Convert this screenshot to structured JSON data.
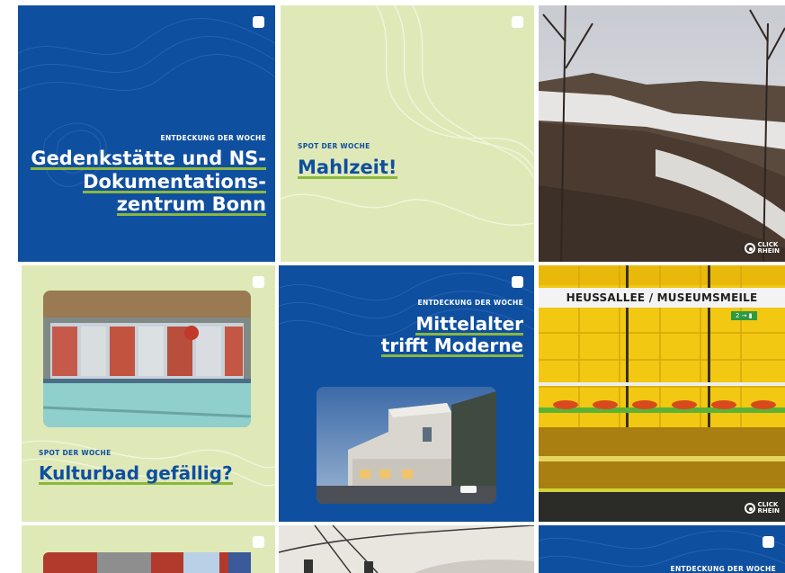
{
  "tiles": {
    "t1": {
      "kicker": "ENTDECKUNG DER WOCHE",
      "lines": [
        "Gedenkstätte und NS-",
        "Dokumentations-",
        "zentrum Bonn"
      ]
    },
    "t2": {
      "kicker": "SPOT DER WOCHE",
      "lines": [
        "Mahlzeit!"
      ]
    },
    "t3": {
      "brand": "CLICK\nRHEIN"
    },
    "t4": {
      "kicker": "SPOT DER WOCHE",
      "lines": [
        "Kulturbad gefällig?"
      ]
    },
    "t5": {
      "kicker": "ENTDECKUNG DER WOCHE",
      "lines": [
        "Mittelalter",
        "trifft Moderne"
      ]
    },
    "t6": {
      "sign": "HEUSSALLEE / MUSEUMSMEILE",
      "sign_small": "2 → ▮",
      "brand": "CLICK\nRHEIN"
    },
    "t9": {
      "kicker": "ENTDECKUNG DER WOCHE"
    }
  },
  "colors": {
    "blue": "#0f4fa0",
    "green": "#dfe9b8",
    "accent": "#8ab83e"
  },
  "icons": [
    "multi-image-icon",
    "clickrhein-logo-icon"
  ]
}
